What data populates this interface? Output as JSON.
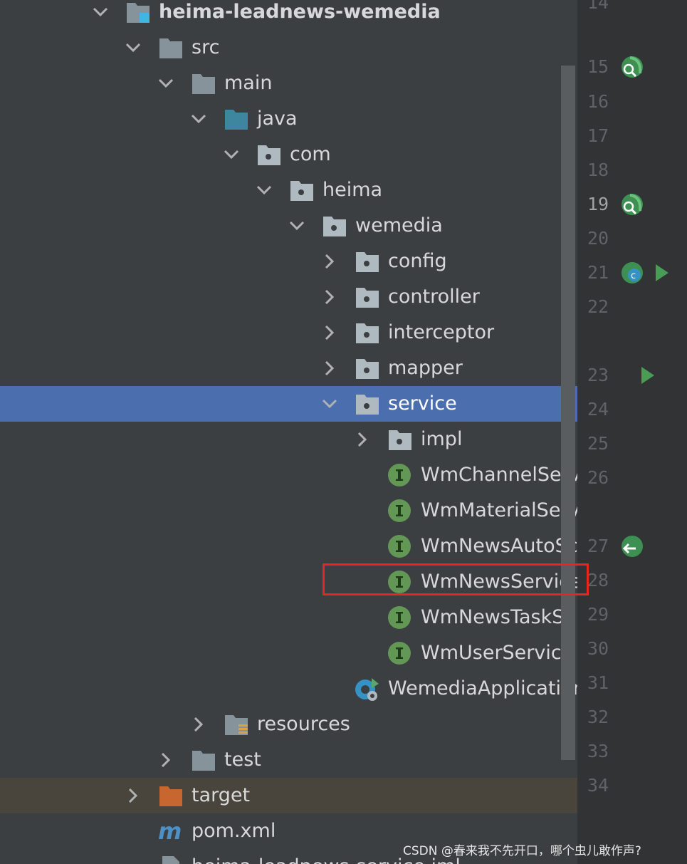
{
  "tree": [
    {
      "label": "heima-leadnews-wemedia",
      "level": 1,
      "expanded": true,
      "icon": "module-folder-icon",
      "bold": true
    },
    {
      "label": "src",
      "level": 2,
      "expanded": true,
      "icon": "folder-icon"
    },
    {
      "label": "main",
      "level": 3,
      "expanded": true,
      "icon": "folder-icon"
    },
    {
      "label": "java",
      "level": 4,
      "expanded": true,
      "icon": "source-folder-icon"
    },
    {
      "label": "com",
      "level": 5,
      "expanded": true,
      "icon": "package-icon"
    },
    {
      "label": "heima",
      "level": 6,
      "expanded": true,
      "icon": "package-icon"
    },
    {
      "label": "wemedia",
      "level": 7,
      "expanded": true,
      "icon": "package-icon"
    },
    {
      "label": "config",
      "level": 8,
      "expanded": false,
      "icon": "package-icon"
    },
    {
      "label": "controller",
      "level": 8,
      "expanded": false,
      "icon": "package-icon"
    },
    {
      "label": "interceptor",
      "level": 8,
      "expanded": false,
      "icon": "package-icon"
    },
    {
      "label": "mapper",
      "level": 8,
      "expanded": false,
      "icon": "package-icon"
    },
    {
      "label": "service",
      "level": 8,
      "expanded": true,
      "icon": "package-icon",
      "selected": true
    },
    {
      "label": "impl",
      "level": 9,
      "expanded": false,
      "icon": "package-icon"
    },
    {
      "label": "WmChannelService",
      "level": 9,
      "icon": "interface-icon"
    },
    {
      "label": "WmMaterialService",
      "level": 9,
      "icon": "interface-icon"
    },
    {
      "label": "WmNewsAutoScanService",
      "level": 9,
      "icon": "interface-icon"
    },
    {
      "label": "WmNewsService",
      "level": 9,
      "icon": "interface-icon",
      "highlighted": true
    },
    {
      "label": "WmNewsTaskService",
      "level": 9,
      "icon": "interface-icon"
    },
    {
      "label": "WmUserService",
      "level": 9,
      "icon": "interface-icon"
    },
    {
      "label": "WemediaApplication",
      "level": 8,
      "icon": "spring-boot-app-icon"
    },
    {
      "label": "resources",
      "level": 4,
      "expanded": false,
      "icon": "resources-folder-icon"
    },
    {
      "label": "test",
      "level": 3,
      "expanded": false,
      "icon": "folder-icon"
    },
    {
      "label": "target",
      "level": 2,
      "expanded": false,
      "icon": "excluded-folder-icon",
      "excluded": true
    },
    {
      "label": "pom.xml",
      "level": 2,
      "icon": "maven-icon"
    },
    {
      "label": "heima-leadnews-service.iml",
      "level": 2,
      "icon": "iml-file-icon"
    }
  ],
  "gutter": {
    "lines": [
      {
        "n": "14",
        "icons": []
      },
      {
        "n": "15",
        "icons": [
          "bean-search-icon"
        ]
      },
      {
        "n": "16",
        "icons": []
      },
      {
        "n": "17",
        "icons": []
      },
      {
        "n": "18",
        "icons": []
      },
      {
        "n": "19",
        "icons": [
          "bean-search-icon"
        ],
        "current": true
      },
      {
        "n": "20",
        "icons": []
      },
      {
        "n": "21",
        "icons": [
          "spring-bean-icon",
          "run-icon"
        ]
      },
      {
        "n": "22",
        "icons": []
      },
      {
        "n": "23",
        "icons": [
          "run-icon"
        ]
      },
      {
        "n": "24",
        "icons": []
      },
      {
        "n": "25",
        "icons": []
      },
      {
        "n": "26",
        "icons": []
      },
      {
        "n": "27",
        "icons": [
          "autowired-icon"
        ]
      },
      {
        "n": "28",
        "icons": []
      },
      {
        "n": "29",
        "icons": []
      },
      {
        "n": "30",
        "icons": []
      },
      {
        "n": "31",
        "icons": []
      },
      {
        "n": "32",
        "icons": []
      },
      {
        "n": "33",
        "icons": []
      },
      {
        "n": "34",
        "icons": []
      }
    ]
  },
  "watermark": "CSDN @春来我不先开口，哪个虫儿敢作声?",
  "colors": {
    "background": "#3c3f41",
    "selection": "#4b6eaf",
    "excluded": "#4a453c",
    "highlight": "#e8251f",
    "interface": "#629755",
    "package": "#aeb9c0",
    "source_folder": "#3e86a0"
  }
}
